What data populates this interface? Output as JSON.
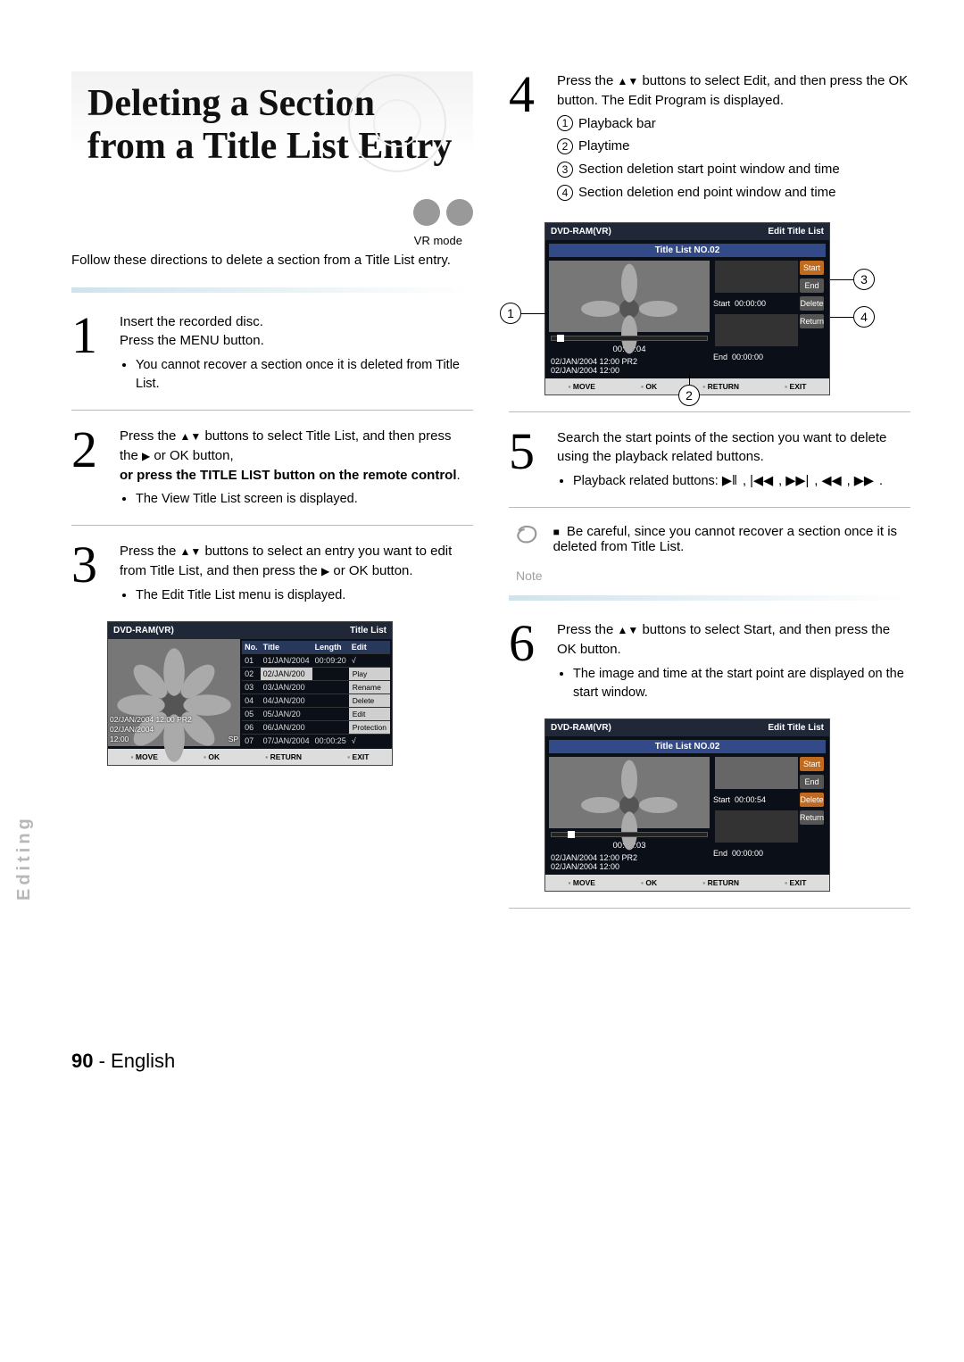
{
  "title": "Deleting a Section from a Title List Entry",
  "mode_label": "VR mode",
  "intro": "Follow these directions to delete a section from a Title List entry.",
  "steps": {
    "s1": {
      "line1": "Insert the recorded disc.",
      "line2": "Press the MENU button.",
      "bullet": "You cannot recover a section once it is deleted from Title List."
    },
    "s2": {
      "line1_a": "Press the ",
      "line1_b": " buttons to select Title List, and then press the ",
      "line1_c": " or OK button,",
      "bold": "or press the TITLE LIST button on the remote control",
      "period": ".",
      "bullet": "The View Title List screen is displayed."
    },
    "s3": {
      "line_a": "Press the ",
      "line_b": " buttons to select an entry you want to edit from Title List, and then press the ",
      "line_c": " or OK button.",
      "bullet": "The Edit Title List menu is displayed."
    },
    "s4": {
      "line_a": "Press the ",
      "line_b": " buttons to select Edit, and then press the OK button. The Edit Program is displayed.",
      "legend": [
        "Playback bar",
        "Playtime",
        "Section deletion start point window and time",
        "Section deletion end point window and time"
      ]
    },
    "s5": {
      "line": "Search the start points of the section you want to delete using the playback related buttons.",
      "bullet": "Playback related buttons: "
    },
    "note": "Be careful, since you cannot recover a section once it is deleted from Title List.",
    "note_label": "Note",
    "s6": {
      "line_a": "Press the ",
      "line_b": " buttons to select Start, and then press the OK button.",
      "bullet": "The image and time at the start point are displayed on the start window."
    }
  },
  "screens": {
    "title_list": {
      "hdr_left": "DVD-RAM(VR)",
      "hdr_right": "Title List",
      "cols": [
        "No.",
        "Title",
        "Length",
        "Edit"
      ],
      "rows": [
        {
          "no": "01",
          "title": "01/JAN/2004",
          "len": "00:09:20",
          "opt": "√"
        },
        {
          "no": "02",
          "title": "02/JAN/200",
          "len": "",
          "opt": "Play"
        },
        {
          "no": "03",
          "title": "03/JAN/200",
          "len": "",
          "opt": "Rename"
        },
        {
          "no": "04",
          "title": "04/JAN/200",
          "len": "",
          "opt": "Delete"
        },
        {
          "no": "05",
          "title": "05/JAN/20",
          "len": "",
          "opt": "Edit"
        },
        {
          "no": "06",
          "title": "06/JAN/200",
          "len": "",
          "opt": "Protection"
        },
        {
          "no": "07",
          "title": "07/JAN/2004",
          "len": "00:00:25",
          "opt": "√"
        }
      ],
      "info1": "02/JAN/2004 12:00 PR2",
      "info2": "02/JAN/2004",
      "info3": "12:00",
      "sp": "SP"
    },
    "edit": {
      "hdr_left": "DVD-RAM(VR)",
      "hdr_right": "Edit Title List",
      "sub": "Title List NO.02",
      "start_label": "Start",
      "end_label": "End",
      "buttons": [
        "Start",
        "End",
        "Delete",
        "Return"
      ],
      "a": {
        "play_time": "00:00:04",
        "start_time": "00:00:00",
        "end_time": "00:00:00",
        "info1": "02/JAN/2004 12:00 PR2",
        "info2": "02/JAN/2004 12:00"
      },
      "b": {
        "play_time": "00:01:03",
        "start_time": "00:00:54",
        "end_time": "00:00:00",
        "info1": "02/JAN/2004 12:00 PR2",
        "info2": "02/JAN/2004 12:00"
      }
    },
    "footer_keys": [
      "MOVE",
      "OK",
      "RETURN",
      "EXIT"
    ]
  },
  "side_tab": "Editing",
  "page_number": "90",
  "page_lang": "English",
  "dash": " - "
}
